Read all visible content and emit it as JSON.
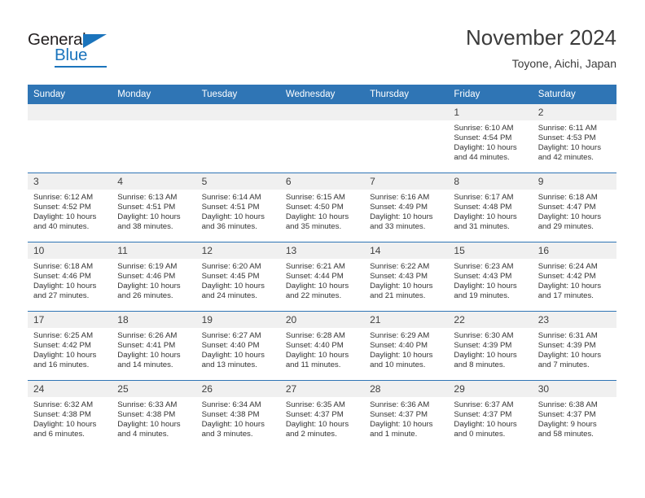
{
  "logo": {
    "word1": "General",
    "word2": "Blue",
    "triangle_color": "#1b74bc"
  },
  "header": {
    "title": "November 2024",
    "subtitle": "Toyone, Aichi, Japan"
  },
  "theme": {
    "header_blue": "#2f75b5",
    "daynum_band": "#f0f0f0",
    "text": "#333333"
  },
  "calendar": {
    "weekday_headers": [
      "Sunday",
      "Monday",
      "Tuesday",
      "Wednesday",
      "Thursday",
      "Friday",
      "Saturday"
    ],
    "labels": {
      "sunrise": "Sunrise:",
      "sunset": "Sunset:",
      "daylight": "Daylight:"
    },
    "weeks": [
      [
        {
          "blank": true
        },
        {
          "blank": true
        },
        {
          "blank": true
        },
        {
          "blank": true
        },
        {
          "blank": true
        },
        {
          "day": "1",
          "sunrise": "Sunrise: 6:10 AM",
          "sunset": "Sunset: 4:54 PM",
          "daylight_l1": "Daylight: 10 hours",
          "daylight_l2": "and 44 minutes."
        },
        {
          "day": "2",
          "sunrise": "Sunrise: 6:11 AM",
          "sunset": "Sunset: 4:53 PM",
          "daylight_l1": "Daylight: 10 hours",
          "daylight_l2": "and 42 minutes."
        }
      ],
      [
        {
          "day": "3",
          "sunrise": "Sunrise: 6:12 AM",
          "sunset": "Sunset: 4:52 PM",
          "daylight_l1": "Daylight: 10 hours",
          "daylight_l2": "and 40 minutes."
        },
        {
          "day": "4",
          "sunrise": "Sunrise: 6:13 AM",
          "sunset": "Sunset: 4:51 PM",
          "daylight_l1": "Daylight: 10 hours",
          "daylight_l2": "and 38 minutes."
        },
        {
          "day": "5",
          "sunrise": "Sunrise: 6:14 AM",
          "sunset": "Sunset: 4:51 PM",
          "daylight_l1": "Daylight: 10 hours",
          "daylight_l2": "and 36 minutes."
        },
        {
          "day": "6",
          "sunrise": "Sunrise: 6:15 AM",
          "sunset": "Sunset: 4:50 PM",
          "daylight_l1": "Daylight: 10 hours",
          "daylight_l2": "and 35 minutes."
        },
        {
          "day": "7",
          "sunrise": "Sunrise: 6:16 AM",
          "sunset": "Sunset: 4:49 PM",
          "daylight_l1": "Daylight: 10 hours",
          "daylight_l2": "and 33 minutes."
        },
        {
          "day": "8",
          "sunrise": "Sunrise: 6:17 AM",
          "sunset": "Sunset: 4:48 PM",
          "daylight_l1": "Daylight: 10 hours",
          "daylight_l2": "and 31 minutes."
        },
        {
          "day": "9",
          "sunrise": "Sunrise: 6:18 AM",
          "sunset": "Sunset: 4:47 PM",
          "daylight_l1": "Daylight: 10 hours",
          "daylight_l2": "and 29 minutes."
        }
      ],
      [
        {
          "day": "10",
          "sunrise": "Sunrise: 6:18 AM",
          "sunset": "Sunset: 4:46 PM",
          "daylight_l1": "Daylight: 10 hours",
          "daylight_l2": "and 27 minutes."
        },
        {
          "day": "11",
          "sunrise": "Sunrise: 6:19 AM",
          "sunset": "Sunset: 4:46 PM",
          "daylight_l1": "Daylight: 10 hours",
          "daylight_l2": "and 26 minutes."
        },
        {
          "day": "12",
          "sunrise": "Sunrise: 6:20 AM",
          "sunset": "Sunset: 4:45 PM",
          "daylight_l1": "Daylight: 10 hours",
          "daylight_l2": "and 24 minutes."
        },
        {
          "day": "13",
          "sunrise": "Sunrise: 6:21 AM",
          "sunset": "Sunset: 4:44 PM",
          "daylight_l1": "Daylight: 10 hours",
          "daylight_l2": "and 22 minutes."
        },
        {
          "day": "14",
          "sunrise": "Sunrise: 6:22 AM",
          "sunset": "Sunset: 4:43 PM",
          "daylight_l1": "Daylight: 10 hours",
          "daylight_l2": "and 21 minutes."
        },
        {
          "day": "15",
          "sunrise": "Sunrise: 6:23 AM",
          "sunset": "Sunset: 4:43 PM",
          "daylight_l1": "Daylight: 10 hours",
          "daylight_l2": "and 19 minutes."
        },
        {
          "day": "16",
          "sunrise": "Sunrise: 6:24 AM",
          "sunset": "Sunset: 4:42 PM",
          "daylight_l1": "Daylight: 10 hours",
          "daylight_l2": "and 17 minutes."
        }
      ],
      [
        {
          "day": "17",
          "sunrise": "Sunrise: 6:25 AM",
          "sunset": "Sunset: 4:42 PM",
          "daylight_l1": "Daylight: 10 hours",
          "daylight_l2": "and 16 minutes."
        },
        {
          "day": "18",
          "sunrise": "Sunrise: 6:26 AM",
          "sunset": "Sunset: 4:41 PM",
          "daylight_l1": "Daylight: 10 hours",
          "daylight_l2": "and 14 minutes."
        },
        {
          "day": "19",
          "sunrise": "Sunrise: 6:27 AM",
          "sunset": "Sunset: 4:40 PM",
          "daylight_l1": "Daylight: 10 hours",
          "daylight_l2": "and 13 minutes."
        },
        {
          "day": "20",
          "sunrise": "Sunrise: 6:28 AM",
          "sunset": "Sunset: 4:40 PM",
          "daylight_l1": "Daylight: 10 hours",
          "daylight_l2": "and 11 minutes."
        },
        {
          "day": "21",
          "sunrise": "Sunrise: 6:29 AM",
          "sunset": "Sunset: 4:40 PM",
          "daylight_l1": "Daylight: 10 hours",
          "daylight_l2": "and 10 minutes."
        },
        {
          "day": "22",
          "sunrise": "Sunrise: 6:30 AM",
          "sunset": "Sunset: 4:39 PM",
          "daylight_l1": "Daylight: 10 hours",
          "daylight_l2": "and 8 minutes."
        },
        {
          "day": "23",
          "sunrise": "Sunrise: 6:31 AM",
          "sunset": "Sunset: 4:39 PM",
          "daylight_l1": "Daylight: 10 hours",
          "daylight_l2": "and 7 minutes."
        }
      ],
      [
        {
          "day": "24",
          "sunrise": "Sunrise: 6:32 AM",
          "sunset": "Sunset: 4:38 PM",
          "daylight_l1": "Daylight: 10 hours",
          "daylight_l2": "and 6 minutes."
        },
        {
          "day": "25",
          "sunrise": "Sunrise: 6:33 AM",
          "sunset": "Sunset: 4:38 PM",
          "daylight_l1": "Daylight: 10 hours",
          "daylight_l2": "and 4 minutes."
        },
        {
          "day": "26",
          "sunrise": "Sunrise: 6:34 AM",
          "sunset": "Sunset: 4:38 PM",
          "daylight_l1": "Daylight: 10 hours",
          "daylight_l2": "and 3 minutes."
        },
        {
          "day": "27",
          "sunrise": "Sunrise: 6:35 AM",
          "sunset": "Sunset: 4:37 PM",
          "daylight_l1": "Daylight: 10 hours",
          "daylight_l2": "and 2 minutes."
        },
        {
          "day": "28",
          "sunrise": "Sunrise: 6:36 AM",
          "sunset": "Sunset: 4:37 PM",
          "daylight_l1": "Daylight: 10 hours",
          "daylight_l2": "and 1 minute."
        },
        {
          "day": "29",
          "sunrise": "Sunrise: 6:37 AM",
          "sunset": "Sunset: 4:37 PM",
          "daylight_l1": "Daylight: 10 hours",
          "daylight_l2": "and 0 minutes."
        },
        {
          "day": "30",
          "sunrise": "Sunrise: 6:38 AM",
          "sunset": "Sunset: 4:37 PM",
          "daylight_l1": "Daylight: 9 hours",
          "daylight_l2": "and 58 minutes."
        }
      ]
    ]
  }
}
